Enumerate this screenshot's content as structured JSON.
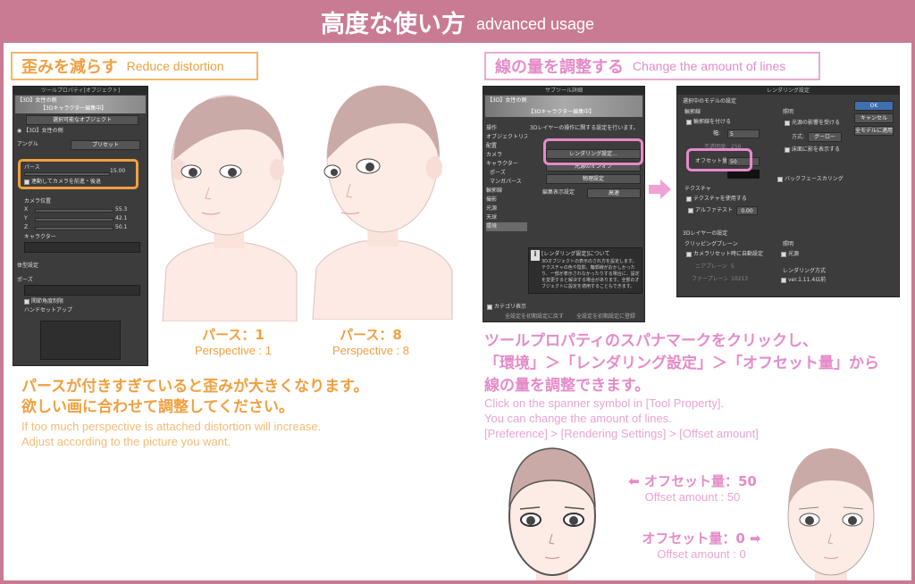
{
  "header": {
    "title_jp": "高度な使い方",
    "title_en": "advanced usage"
  },
  "left_section": {
    "heading_jp": "歪みを減らす",
    "heading_en": "Reduce distortion",
    "panel": {
      "title": "ツールプロパティ[オブジェクト]",
      "tag": "【3D】女性の側",
      "edit_label": "【3Dキャラクター編集中】",
      "selectable": "選択可能なオブジェクト",
      "object_name": "【3D】女性の側",
      "angle_label": "アングル",
      "preset_label": "プリセット",
      "perspective_label": "パース",
      "perspective_value": "15.00",
      "link_camera_label": "連動してカメラを前進・後退",
      "camera_pos_label": "カメラ位置",
      "x_label": "X",
      "x_value": "55.3",
      "y_label": "Y",
      "y_value": "42.1",
      "z_label": "Z",
      "z_value": "50.1",
      "character_label": "キャラクター",
      "body_shape_label": "体型設定",
      "pose_label": "ポーズ",
      "joint_limit_label": "関節角度制限",
      "hand_setup_label": "ハンドセットアップ"
    },
    "illus_1": {
      "label_jp": "パース：1",
      "label_en": "Perspective : 1"
    },
    "illus_8": {
      "label_jp": "パース：8",
      "label_en": "Perspective : 8"
    },
    "caption_jp_1": "パースが付きすぎていると歪みが大きくなります。",
    "caption_jp_2": "欲しい画に合わせて調整してください。",
    "caption_en_1": "If too much perspective is attached distortion will increase.",
    "caption_en_2": "Adjust according to the picture you want."
  },
  "right_section": {
    "heading_jp": "線の量を調整する",
    "heading_en": "Change the amount of lines",
    "sub_panel": {
      "title": "サブツール詳細",
      "tag": "【3D】女性の側",
      "edit_label": "【3Dキャラクター編集中】",
      "desc_top": "3Dレイヤーの操作に関する設定を行います。",
      "categories": [
        "操作",
        "オブジェクトリスト",
        "配置",
        "カメラ",
        "キャラクター",
        "ポーズ",
        "マンガパース",
        "輪郭線",
        "撮影",
        "光源",
        "天球",
        "環境"
      ],
      "render_btn": "レンダリング設定...",
      "light_btn": "光源のオンオフ",
      "physics_btn": "物理設定",
      "edit_quality_label": "編集表示設定",
      "edit_quality_value": "高速",
      "info_title": "[レンダリング設定]について",
      "info_body": "3Dオブジェクトの表示のされ方を設定します。テクスチャの色や陰影、輪郭線がおかしかったり、一部が表示されなかったりする場合に、設定を変更すると解決する場合があります。全部のオブジェクトに設定を適用することもできます。",
      "category_display": "カテゴリ表示",
      "reset_btn": "全設定を初期設定に戻す",
      "register_btn": "全設定を初期設定に登録"
    },
    "render_panel": {
      "title": "レンダリング設定",
      "group_model": "選択中のモデルの設定",
      "outline_group": "輪郭線",
      "outline_apply": "輪郭線を付ける",
      "width_label": "幅:",
      "width_value": "5",
      "accuracy_label": "不透明度:",
      "accuracy_value": "256",
      "offset_label": "オフセット量:",
      "offset_value": "50",
      "lighting_group": "照明",
      "light_effect": "光源の影響を受ける",
      "method_label": "方式:",
      "method_value": "グーロー",
      "shadow_label": "床面に影を表示する",
      "backface_label": "バックフェースカリング",
      "texture_group": "テクスチャ",
      "use_texture": "テクスチャを使用する",
      "alpha_test": "アルファテスト",
      "alpha_value": "0.00",
      "layer_group": "3Dレイヤーの設定",
      "clip_group": "クリッピングプレーン",
      "camera_auto": "カメラリセット時に自動設定",
      "near_label": "ニアプレーン:",
      "near_value": "5",
      "far_label": "ファープレーン:",
      "far_value": "10213",
      "lighting2_group": "照明",
      "light2_label": "光源",
      "render_method_group": "レンダリング方式",
      "render_method_value": "ver.1.11.4以前",
      "ok_btn": "OK",
      "cancel_btn": "キャンセル",
      "apply_all_btn": "全モデルに適用"
    },
    "caption_jp_1": "ツールプロパティのスパナマークをクリックし、",
    "caption_jp_2": "「環境」＞「レンダリング設定」＞「オフセット量」から",
    "caption_jp_3": "線の量を調整できます。",
    "caption_en_1": "Click on the spanner symbol in [Tool Property].",
    "caption_en_2": "You can change the amount of lines.",
    "caption_en_3": "[Preference] > [Rendering Settings] > [Offset amount]",
    "offset_50": {
      "label_jp": "オフセット量：50",
      "label_en": "Offset amount : 50"
    },
    "offset_0": {
      "label_jp": "オフセット量：0",
      "label_en": "Offset amount : 0"
    }
  },
  "colors": {
    "header": "#c97b93",
    "orange": "#f0a040",
    "pink": "#e58bc8"
  }
}
